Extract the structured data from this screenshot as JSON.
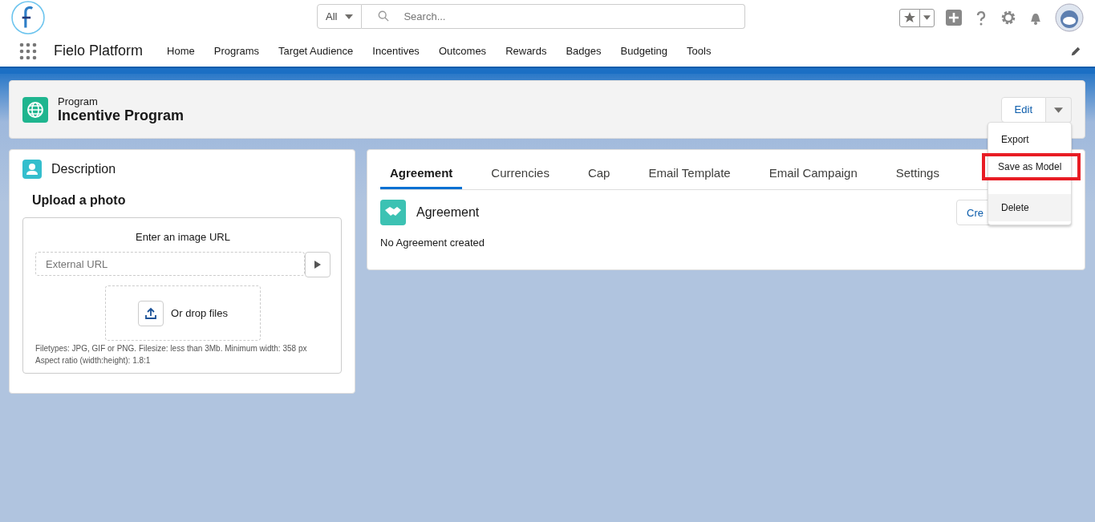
{
  "search": {
    "scope": "All",
    "placeholder": "Search..."
  },
  "app_name": "Fielo Platform",
  "nav": [
    "Home",
    "Programs",
    "Target Audience",
    "Incentives",
    "Outcomes",
    "Rewards",
    "Badges",
    "Budgeting",
    "Tools"
  ],
  "record": {
    "type": "Program",
    "name": "Incentive Program",
    "edit": "Edit"
  },
  "menu": [
    {
      "label": "Export",
      "hovered": false,
      "outlined": false
    },
    {
      "label": "Save as Model",
      "hovered": false,
      "outlined": true
    },
    {
      "label": "Delete",
      "hovered": true,
      "outlined": false
    }
  ],
  "description": {
    "title": "Description",
    "upload_title": "Upload a photo",
    "url_label": "Enter an image URL",
    "url_placeholder": "External URL",
    "drop": "Or drop files",
    "help": [
      "Filetypes: JPG, GIF or PNG. Filesize: less than 3Mb. Minimum width: 358 px",
      "Aspect ratio (width:height): 1.8:1"
    ]
  },
  "tabs": [
    {
      "label": "Agreement",
      "selected": true
    },
    {
      "label": "Currencies",
      "selected": false
    },
    {
      "label": "Cap",
      "selected": false
    },
    {
      "label": "Email Template",
      "selected": false
    },
    {
      "label": "Email Campaign",
      "selected": false
    },
    {
      "label": "Settings",
      "selected": false
    }
  ],
  "agreement": {
    "title": "Agreement",
    "create": "Cre",
    "empty": "No Agreement created"
  }
}
